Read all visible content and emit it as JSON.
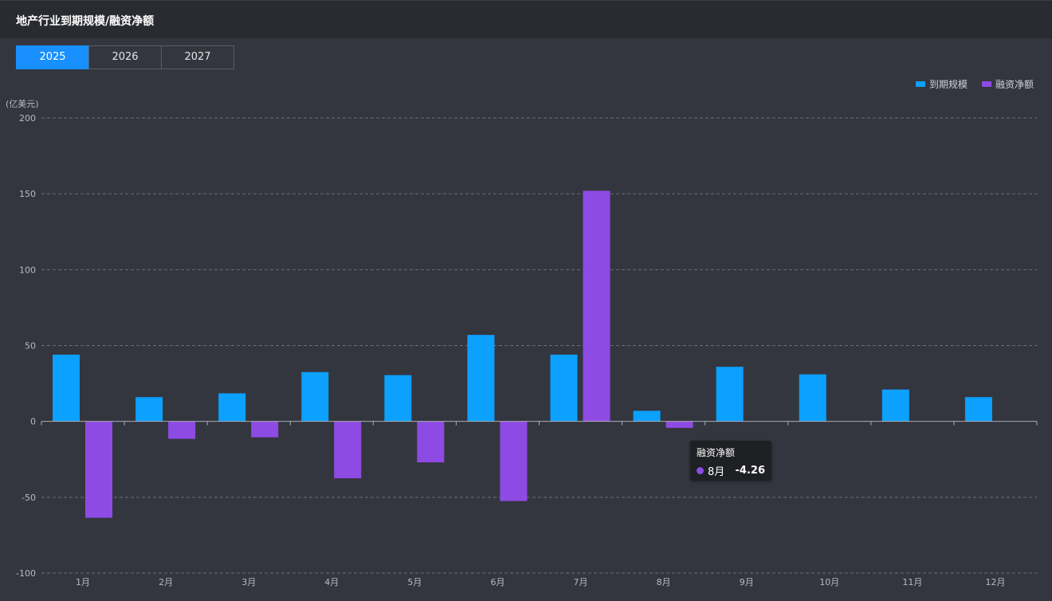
{
  "header": {
    "title": "地产行业到期规模/融资净额"
  },
  "tabs": [
    {
      "label": "2025",
      "active": true
    },
    {
      "label": "2026",
      "active": false
    },
    {
      "label": "2027",
      "active": false
    }
  ],
  "legend": [
    {
      "label": "到期规模",
      "color": "#0ca0ff"
    },
    {
      "label": "融资净额",
      "color": "#8e4be4"
    }
  ],
  "colors": {
    "maturity": "#0ca0ff",
    "net_financing": "#8e4be4",
    "grid": "#6b6e77",
    "axis": "#a9acb3",
    "tick_text": "#b7bac1"
  },
  "tooltip": {
    "title": "融资净额",
    "category": "8月",
    "value": "-4.26"
  },
  "chart_data": {
    "type": "bar",
    "unit_label": "(亿美元)",
    "categories": [
      "1月",
      "2月",
      "3月",
      "4月",
      "5月",
      "6月",
      "7月",
      "8月",
      "9月",
      "10月",
      "11月",
      "12月"
    ],
    "series": [
      {
        "name": "到期规模",
        "values": [
          44,
          16,
          18.5,
          32.5,
          30.5,
          57,
          44,
          7,
          36,
          31,
          21,
          16
        ]
      },
      {
        "name": "融资净额",
        "values": [
          -63.5,
          -11.5,
          -10.5,
          -37.5,
          -27,
          -52.5,
          152,
          -4.26,
          null,
          null,
          null,
          null
        ]
      }
    ],
    "ylim": [
      -100,
      200
    ],
    "yticks": [
      -100,
      -50,
      0,
      50,
      100,
      150,
      200
    ],
    "grid": true,
    "legend_position": "top-right"
  }
}
